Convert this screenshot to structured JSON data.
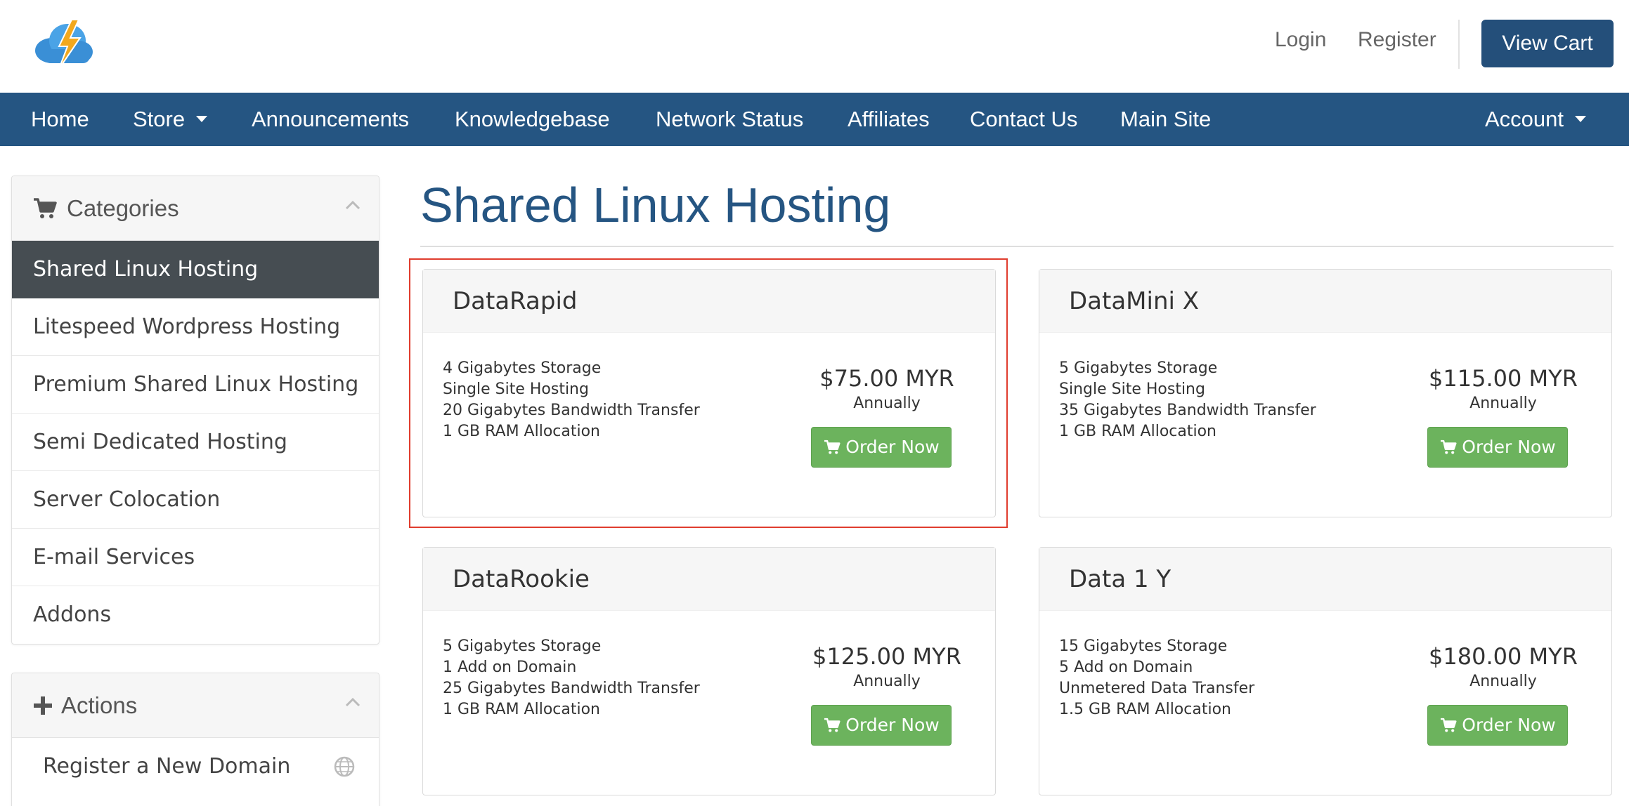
{
  "header": {
    "login": "Login",
    "register": "Register",
    "view_cart": "View Cart"
  },
  "nav": {
    "items": [
      "Home",
      "Store",
      "Announcements",
      "Knowledgebase",
      "Network Status",
      "Affiliates",
      "Contact Us",
      "Main Site"
    ],
    "account": "Account"
  },
  "sidebar": {
    "categories_title": "Categories",
    "categories": [
      "Shared Linux Hosting",
      "Litespeed Wordpress Hosting",
      "Premium Shared Linux Hosting",
      "Semi Dedicated Hosting",
      "Server Colocation",
      "E-mail Services",
      "Addons"
    ],
    "actions_title": "Actions",
    "actions": [
      "Register a New Domain"
    ]
  },
  "main": {
    "title": "Shared Linux Hosting",
    "products": [
      {
        "name": "DataRapid",
        "features": [
          "4 Gigabytes Storage",
          "Single Site Hosting",
          "20 Gigabytes Bandwidth Transfer",
          "1 GB RAM Allocation"
        ],
        "price": "$75.00 MYR",
        "cycle": "Annually",
        "button": "Order Now"
      },
      {
        "name": "DataMini X",
        "features": [
          "5 Gigabytes Storage",
          "Single Site Hosting",
          "35 Gigabytes Bandwidth Transfer",
          "1 GB RAM Allocation"
        ],
        "price": "$115.00 MYR",
        "cycle": "Annually",
        "button": "Order Now"
      },
      {
        "name": "DataRookie",
        "features": [
          "5 Gigabytes Storage",
          "1 Add on Domain",
          "25 Gigabytes Bandwidth Transfer",
          "1 GB RAM Allocation"
        ],
        "price": "$125.00 MYR",
        "cycle": "Annually",
        "button": "Order Now"
      },
      {
        "name": "Data 1 Y",
        "features": [
          "15 Gigabytes Storage",
          "5 Add on Domain",
          "Unmetered Data Transfer",
          "1.5 GB RAM Allocation"
        ],
        "price": "$180.00 MYR",
        "cycle": "Annually",
        "button": "Order Now"
      }
    ]
  },
  "colors": {
    "brand": "#255582",
    "active_category": "#464d52",
    "order_button": "#6cb35d",
    "highlight": "#e03d2e"
  },
  "icons": [
    "cloud-lightning-logo",
    "cart-icon",
    "plus-icon",
    "chevron-up-icon",
    "globe-icon",
    "caret-down-icon"
  ]
}
